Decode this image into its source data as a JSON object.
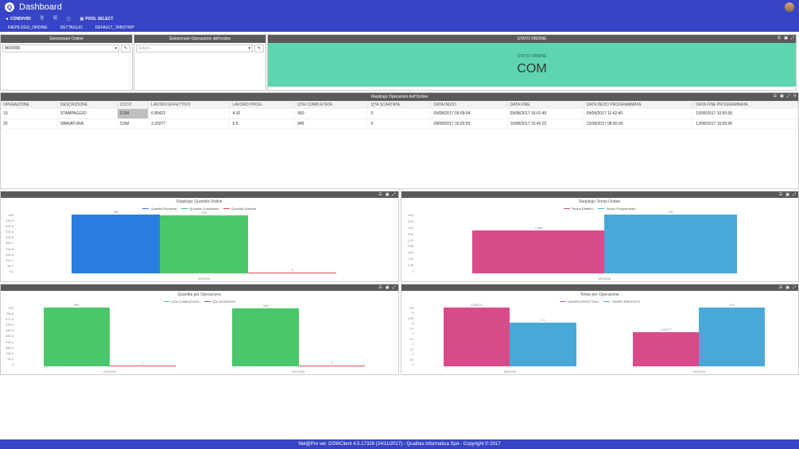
{
  "header": {
    "title": "Dashboard"
  },
  "menu": {
    "condividi": "CONDIVIDI",
    "poolselect": "POOL SELECT"
  },
  "tabs": [
    "RIEPILOGO_ORDINE",
    "DETTAGLIO",
    "DEFAULT_TABSTRIP"
  ],
  "sel_ordine": {
    "title": "Selezionare Ordine",
    "value": "MO0006"
  },
  "sel_op": {
    "title": "Selezionare Operazione dell'ordine",
    "placeholder": "Select..."
  },
  "stato": {
    "title": "STATO ORDINE",
    "label": "STATO ORDINE",
    "value": "COM"
  },
  "table": {
    "title": "Riepilogo Operazioni dell'Ordine",
    "cols": [
      "OPERAZIONE",
      "DESCRIZIONE",
      "CDCO",
      "LAVORO EFFETTIVO",
      "LAVORO PROG.",
      "QTA COMPLETATA",
      "QTA SCARTATA",
      "DATA INIZIO",
      "DATA FINE",
      "DATA INIZIO PROGRAMMATA",
      "DATA FINE PROGRAMMATA"
    ],
    "rows": [
      [
        "10",
        "STAMPAGGIO",
        "COM",
        "6.85422",
        "4.10",
        "960",
        "0",
        "09/08/2017 09:09:04",
        "09/08/2017 16:01:49",
        "09/08/2017 11:42:40",
        "10/08/2017 10:50:00"
      ],
      [
        "20",
        "SBAVATURA",
        "COM",
        "3.20277",
        "5.5",
        "945",
        "5",
        "09/08/2017 16:02:55",
        "10/08/2017 15:42:22",
        "12/08/2017 08:50:00",
        "12/08/2017 15:50:00"
      ]
    ]
  },
  "chart_data": [
    {
      "id": "riepilogo_quantita",
      "type": "bar",
      "title": "Riepilogo Quantità Ordine",
      "categories": [
        "MO0006"
      ],
      "series": [
        {
          "name": "Quantità Richiesta",
          "color": "#2a7de1",
          "values": [
            960
          ]
        },
        {
          "name": "Quantità Completata",
          "color": "#4cc66b",
          "values": [
            945
          ]
        },
        {
          "name": "Quantità Scartata",
          "color": "#d84b4b",
          "values": [
            5
          ]
        }
      ],
      "ylim": [
        0,
        960
      ],
      "yticks": [
        "0.1",
        "96.1",
        "192.1",
        "289.6",
        "318.8",
        "385.7",
        "445.8",
        "576.6",
        "672.6",
        "768.5",
        "960"
      ]
    },
    {
      "id": "riepilogo_tempi",
      "type": "bar",
      "title": "Riepilogo Tempi Ordine",
      "categories": [
        "MO0006"
      ],
      "series": [
        {
          "name": "Tempo Effettivo",
          "color": "#d84b8a",
          "values": [
            7.056
          ]
        },
        {
          "name": "Tempo Programmato",
          "color": "#4aa8d8",
          "values": [
            9.6
          ]
        }
      ],
      "ylim": [
        0,
        9.6
      ],
      "yticks": [
        "0",
        "0.96",
        "1.92",
        "2.62",
        "2.88",
        "2.97",
        "5.40",
        "4.00",
        "6.00",
        "9.60"
      ],
      "labels": [
        "7.056",
        "9.60"
      ]
    },
    {
      "id": "quantita_per_op",
      "type": "bar",
      "title": "Quantità per Operazione",
      "categories": [
        "MO0006",
        "MO0006"
      ],
      "series": [
        {
          "name": "QTA COMPLETATA",
          "color": "#4cc66b",
          "values": [
            960,
            945
          ]
        },
        {
          "name": "QTA SCARTATA",
          "color": "#d84b4b",
          "values": [
            0,
            5
          ]
        }
      ],
      "ylim": [
        0,
        960
      ],
      "yticks": [
        "0",
        "96.1",
        "195.2",
        "286.6",
        "318.8",
        "385.4",
        "448.9",
        "576.6",
        "672.6",
        "768.5",
        "960"
      ],
      "labels": [
        "960",
        "0",
        "945",
        "5"
      ]
    },
    {
      "id": "tempi_per_op",
      "type": "bar",
      "title": "Tempi per Operazione",
      "categories": [
        "MO0006",
        "MO0006"
      ],
      "series": [
        {
          "name": "LAVORO EFFETTIVO",
          "color": "#d84b8a",
          "values": [
            6.85422,
            3.20277
          ]
        },
        {
          "name": "TEMPO PREVISTO",
          "color": "#4aa8d8",
          "values": [
            4.1,
            5.5
          ]
        }
      ],
      "ylim": [
        0,
        5.5
      ],
      "yticks": [
        "0",
        "0.5",
        "1",
        "1.5",
        "2",
        "2.5",
        "3",
        "3.5",
        "4",
        "4.55",
        "5",
        "5.5"
      ],
      "labels": [
        "6.85422",
        "4.10",
        "3.20277",
        "5.5"
      ]
    }
  ],
  "footer": "Net@Pro ver. DSWClient 4.5.17328 (24/11/2017) - Qualitas Informatica SpA - Copyright © 2017"
}
